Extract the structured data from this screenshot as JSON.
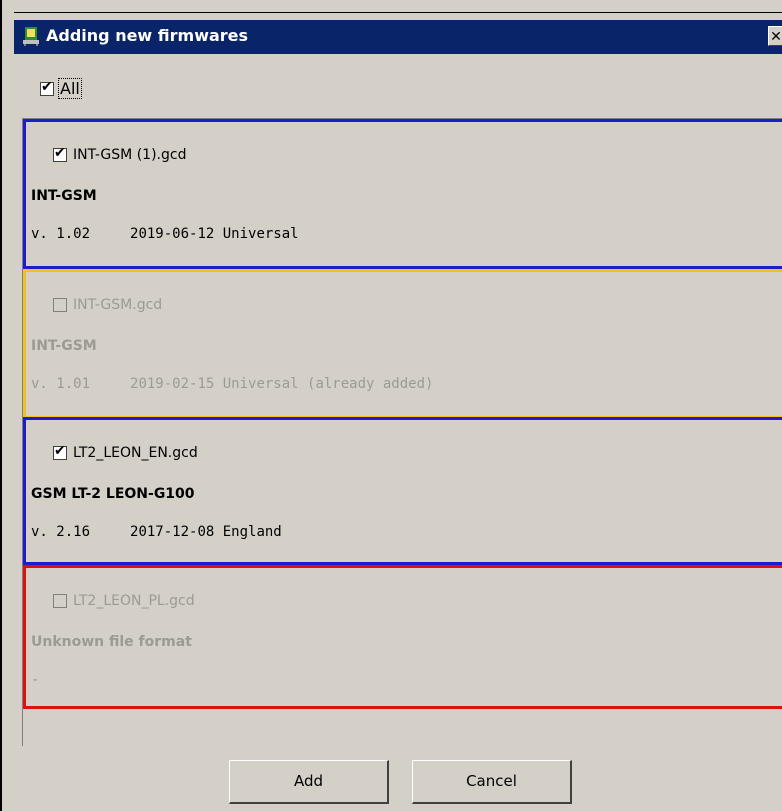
{
  "window": {
    "title": "Adding new firmwares",
    "close_glyph": "✕"
  },
  "all_checkbox": {
    "label": "All",
    "checked": true
  },
  "items": [
    {
      "file": "INT-GSM (1).gcd",
      "device": "INT-GSM",
      "version": "v. 1.02",
      "date_info": "2019-06-12 Universal",
      "checked": true,
      "enabled": true,
      "border_color": "#1c1ccc"
    },
    {
      "file": "INT-GSM.gcd",
      "device": "INT-GSM",
      "version": "v. 1.01",
      "date_info": "2019-02-15 Universal (already added)",
      "checked": false,
      "enabled": false,
      "border_color": "#f0c020"
    },
    {
      "file": "LT2_LEON_EN.gcd",
      "device": "GSM LT-2 LEON-G100",
      "version": "v. 2.16",
      "date_info": "2017-12-08 England",
      "checked": true,
      "enabled": true,
      "border_color": "#1c1ccc"
    },
    {
      "file": "LT2_LEON_PL.gcd",
      "device": "Unknown file format",
      "version": "-",
      "date_info": "",
      "checked": false,
      "enabled": false,
      "border_color": "#e01010"
    }
  ],
  "buttons": {
    "add": "Add",
    "cancel": "Cancel"
  }
}
